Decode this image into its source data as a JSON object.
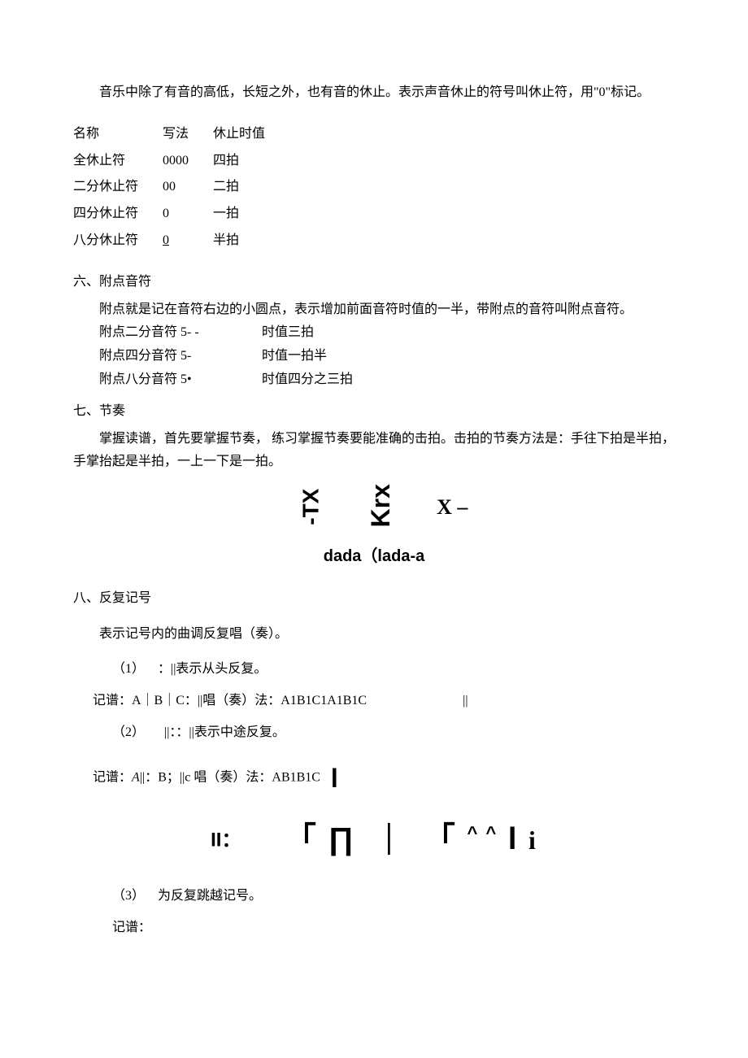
{
  "intro_paragraph": "音乐中除了有音的高低，长短之外，也有音的休止。表示声音休止的符号叫休止符，用\"0\"标记。",
  "rest_table": {
    "header": {
      "name": "名称",
      "notation": "写法",
      "duration": "休止时值"
    },
    "rows": [
      {
        "name": "全休止符",
        "notation": "0000",
        "duration": "四拍"
      },
      {
        "name": "二分休止符",
        "notation": "00",
        "duration": "二拍"
      },
      {
        "name": "四分休止符",
        "notation": "0",
        "duration": "一拍"
      },
      {
        "name": "八分休止符",
        "notation_top": "0",
        "duration": "半拍"
      }
    ]
  },
  "section6": {
    "title": "六、附点音符",
    "body": "附点就是记在音符右边的小圆点，表示增加前面音符时值的一半，带附点的音符叫附点音符。",
    "items": [
      {
        "left": "附点二分音符 5- -",
        "right": "时值三拍"
      },
      {
        "left": "附点四分音符 5-",
        "right": "时值一拍半"
      },
      {
        "left": "附点八分音符 5•",
        "right": "时值四分之三拍"
      }
    ]
  },
  "section7": {
    "title": "七、节奏",
    "body": "掌握读谱，首先要掌握节奏，    练习掌握节奏要能准确的击拍。击拍的节奏方法是：手往下拍是半拍，手掌抬起是半拍，一上一下是一拍。",
    "rhythm1": "-TX",
    "rhythm2": "Krx",
    "rhythm3": "X –",
    "dada": "dada（lada-a"
  },
  "section8": {
    "title": "八、反复记号",
    "intro": "表示记号内的曲调反复唱（奏）。",
    "item1_label": "（1）",
    "item1_text": "：||表示从头反复。",
    "item1_notation": "记谱：A｜B｜C：||唱（奏）法：A1B1C1A1B1C",
    "item1_trail": "||",
    "item2_label": "（2）",
    "item2_text": "||：：||表示中途反复。",
    "item2_notation_prefix": "记谱：",
    "item2_notation_a": "A",
    "item2_notation_mid": "||：B；||c 唱（奏）法：AB1B1C",
    "repeat_sym_left": "II：",
    "repeat_sym_right": "「 ∏ ｜ 「 ^ ^ l i",
    "item3_label": "（3）",
    "item3_text": "为反复跳越记号。",
    "item3_notation": "记谱："
  }
}
